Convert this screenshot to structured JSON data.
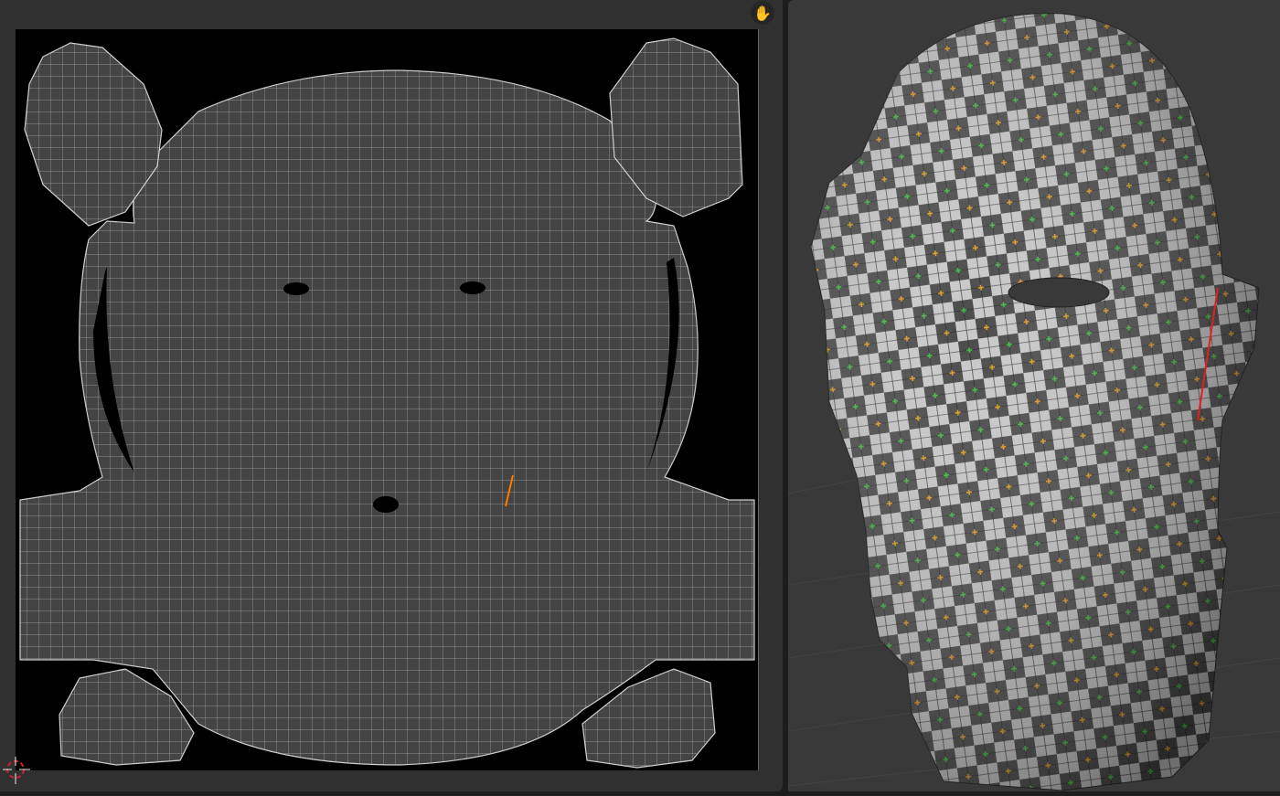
{
  "uv_editor": {
    "background": "#303030",
    "canvas_color": "#000000",
    "island_fill": "#444444",
    "edge_color": "#bdbdbd",
    "seam_color": "#ff7a00",
    "tool_icon": "hand-pan-icon",
    "cursor_icon": "2d-cursor-icon"
  },
  "viewport": {
    "background": "#393939",
    "checker_light": "#c9c9c9",
    "checker_dark": "#4b4b4b",
    "seam_color": "#e02020"
  }
}
